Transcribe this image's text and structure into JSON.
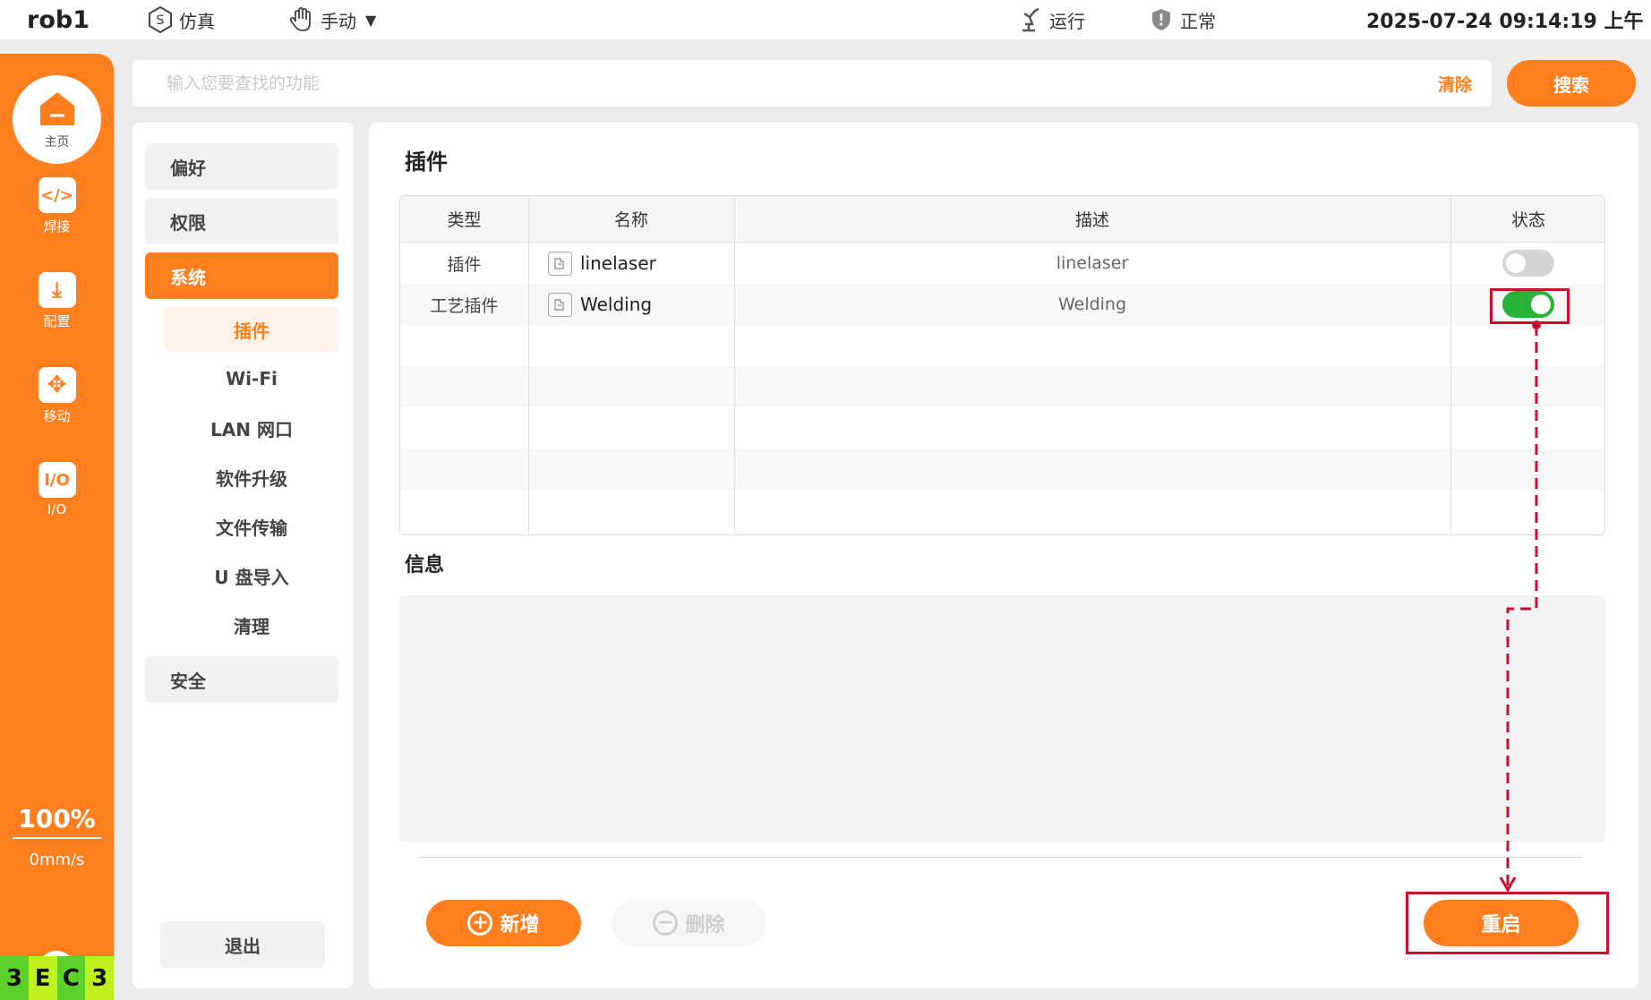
{
  "topbar": {
    "title": "rob1",
    "sim_label": "仿真",
    "mode_label": "手动",
    "run_label": "运行",
    "status_label": "正常",
    "datetime": "2025-07-24 09:14:19 上午"
  },
  "rail": {
    "home_label": "主页",
    "items": [
      {
        "label": "焊接",
        "glyph": "</>",
        "icon": "code-icon"
      },
      {
        "label": "配置",
        "glyph": "⤓",
        "icon": "download-icon"
      },
      {
        "label": "移动",
        "glyph": "✥",
        "icon": "move-icon"
      },
      {
        "label": "I/O",
        "glyph": "I/O",
        "icon": "io-icon"
      }
    ],
    "speed_pct": "100%",
    "speed_value": "0mm/s",
    "footer_letters": [
      "3",
      "E",
      "C",
      "3"
    ]
  },
  "search": {
    "placeholder": "输入您要查找的功能",
    "clear_label": "清除",
    "button_label": "搜索"
  },
  "nav": {
    "preference": "偏好",
    "permission": "权限",
    "system": "系统",
    "sub_items": [
      "插件",
      "Wi-Fi",
      "LAN 网口",
      "软件升级",
      "文件传输",
      "U 盘导入",
      "清理"
    ],
    "security": "安全",
    "logout": "退出"
  },
  "main": {
    "title": "插件",
    "columns": [
      "类型",
      "名称",
      "描述",
      "状态"
    ],
    "rows": [
      {
        "type": "插件",
        "name": "linelaser",
        "description": "linelaser",
        "enabled": false
      },
      {
        "type": "工艺插件",
        "name": "Welding",
        "description": "Welding",
        "enabled": true
      }
    ],
    "info_title": "信息",
    "add_label": "新增",
    "delete_label": "删除",
    "restart_label": "重启"
  },
  "colors": {
    "accent": "#ff7f1f",
    "toggle_on": "#27b33a",
    "toggle_off": "#d4d4d4",
    "annotation": "#c8102e"
  }
}
